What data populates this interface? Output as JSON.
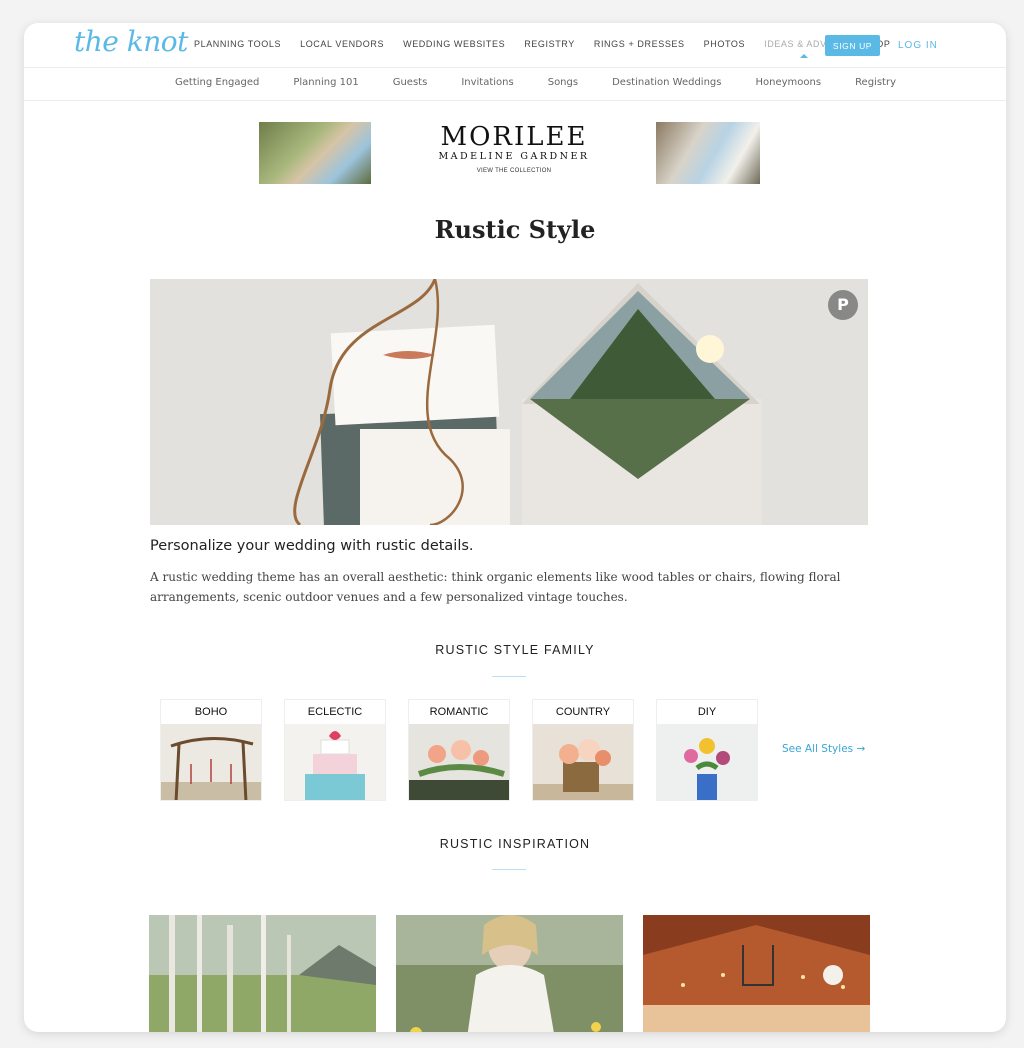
{
  "header": {
    "logo": "the knot",
    "menu": [
      "PLANNING TOOLS",
      "LOCAL VENDORS",
      "WEDDING WEBSITES",
      "REGISTRY",
      "RINGS + DRESSES",
      "PHOTOS",
      "IDEAS & ADVICE",
      "SHOP"
    ],
    "active_menu": "IDEAS & ADVICE",
    "signup_label": "SIGN UP",
    "login_label": "LOG IN"
  },
  "subnav": [
    "Getting Engaged",
    "Planning 101",
    "Guests",
    "Invitations",
    "Songs",
    "Destination Weddings",
    "Honeymoons",
    "Registry"
  ],
  "ad": {
    "brand": "MORILEE",
    "sub": "MADELINE GARDNER",
    "cta": "VIEW THE COLLECTION"
  },
  "page": {
    "title": "Rustic Style",
    "subtitle": "Personalize your wedding with rustic details.",
    "description": "A rustic wedding theme has an overall aesthetic: think organic elements like wood tables or chairs, flowing floral arrangements, scenic outdoor venues and a few personalized vintage touches."
  },
  "style_family": {
    "heading": "RUSTIC STYLE FAMILY",
    "items": [
      "BOHO",
      "ECLECTIC",
      "ROMANTIC",
      "COUNTRY",
      "DIY"
    ],
    "see_all": "See All Styles →"
  },
  "inspiration": {
    "heading": "RUSTIC INSPIRATION"
  },
  "colors": {
    "accent": "#5bb9e6",
    "link": "#3aa6d6"
  },
  "icons": {
    "pinterest": "pinterest-icon"
  },
  "hero_pin_glyph": "P"
}
